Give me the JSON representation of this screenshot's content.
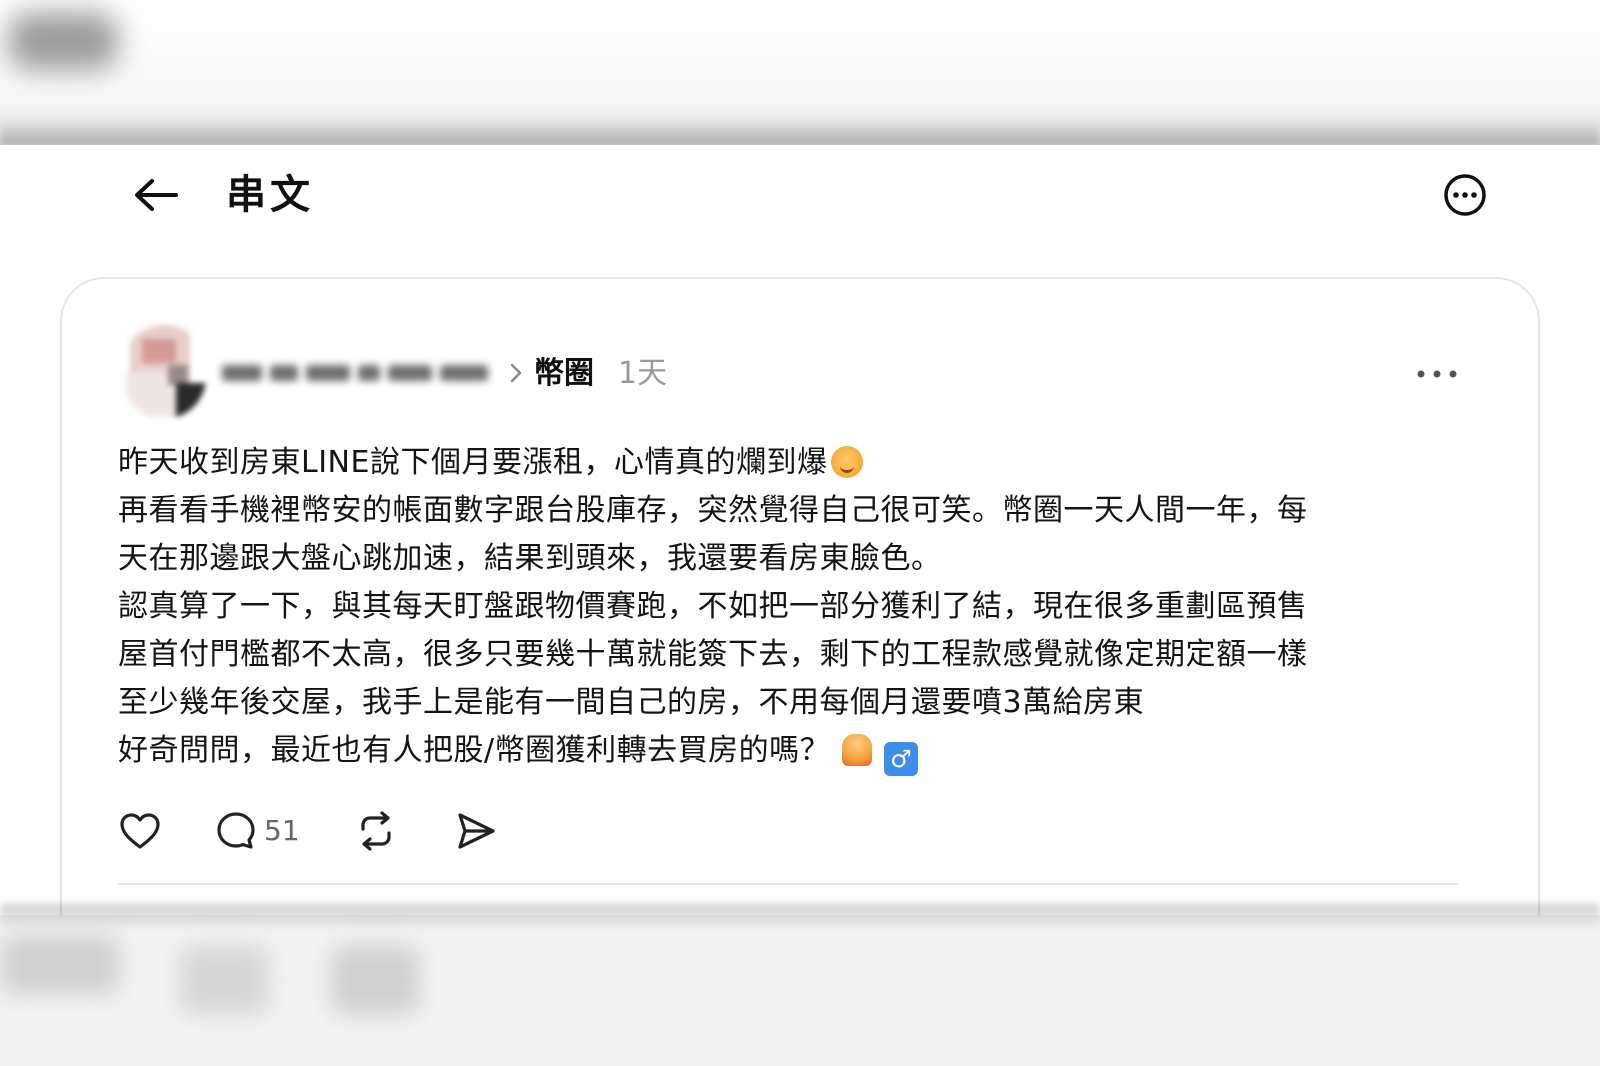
{
  "header": {
    "title": "串文",
    "back_icon": "arrow-left-icon",
    "more_icon": "circle-ellipsis-icon"
  },
  "post": {
    "topic": "幣圈",
    "time": "1天",
    "lines": [
      "昨天收到房東LINE說下個月要漲租，心情真的爛到爆",
      "再看看手機裡幣安的帳面數字跟台股庫存，突然覺得自己很可笑。幣圈一天人間一年，每",
      "天在那邊跟大盤心跳加速，結果到頭來，我還要看房東臉色。",
      "認真算了一下，與其每天盯盤跟物價賽跑，不如把一部分獲利了結，現在很多重劃區預售",
      "屋首付門檻都不太高，很多只要幾十萬就能簽下去，剩下的工程款感覺就像定期定額一樣",
      "至少幾年後交屋，我手上是能有一間自己的房，不用每個月還要噴3萬給房東",
      "好奇問問，最近也有人把股/幣圈獲利轉去買房的嗎？"
    ],
    "emojis": {
      "line1": "blushing-face-emoji",
      "line7": [
        "person-raising-hand-emoji",
        "male-sign-emoji"
      ],
      "male_sign": "♂"
    },
    "actions": {
      "like_icon": "heart-icon",
      "reply_icon": "comment-bubble-icon",
      "reply_count": "51",
      "repost_icon": "repost-icon",
      "share_icon": "send-icon"
    }
  },
  "colors": {
    "text": "#141414",
    "muted": "#9a9a9a",
    "border": "#e6e6e6",
    "male_sign_bg": "#3d8ee8"
  }
}
